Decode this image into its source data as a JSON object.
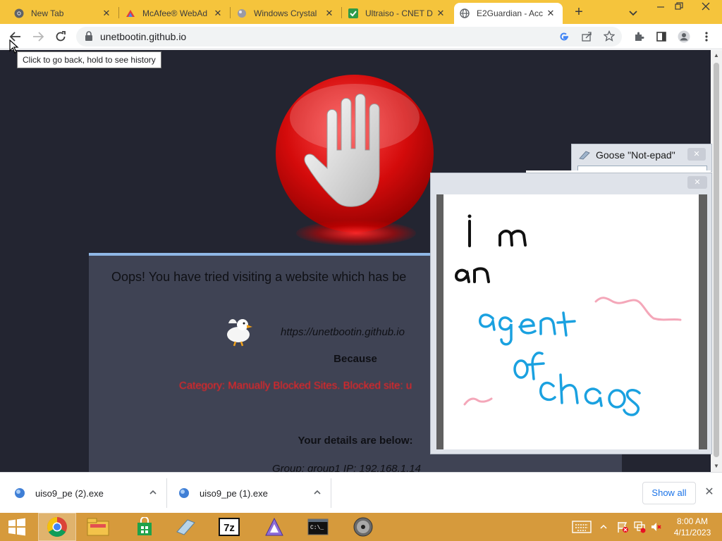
{
  "browser": {
    "tabs": [
      {
        "title": "New Tab",
        "active": false,
        "icon": "chrome-icon"
      },
      {
        "title": "McAfee® WebAd",
        "active": false,
        "icon": "mcafee-icon"
      },
      {
        "title": "Windows Crystal",
        "active": false,
        "icon": "crystal-icon"
      },
      {
        "title": "Ultraiso - CNET D",
        "active": false,
        "icon": "cnet-icon"
      },
      {
        "title": "E2Guardian - Acc",
        "active": true,
        "icon": "globe-icon"
      }
    ],
    "new_tab_label": "+",
    "url": "unetbootin.github.io",
    "back_tooltip": "Click to go back, hold to see history"
  },
  "page": {
    "heading": "Oops! You have tried visiting a website which has be",
    "blocked_url": "https://unetbootin.github.io",
    "because_label": "Because",
    "category_text": "Category: Manually Blocked Sites.  Blocked site: u",
    "details_heading": "Your details are below:",
    "group_ip": "Group: group1    IP: 192.168.1.14"
  },
  "notepad": {
    "title": "Goose \"Not-epad\"",
    "close_glyph": "✕",
    "handwriting": {
      "line1": "i m",
      "line2": "an",
      "line3": "agent",
      "line4": "of",
      "line5": "chaos"
    }
  },
  "downloads": {
    "items": [
      {
        "name": "uiso9_pe (2).exe"
      },
      {
        "name": "uiso9_pe (1).exe"
      }
    ],
    "show_all_label": "Show all",
    "close_glyph": "✕"
  },
  "taskbar": {
    "apps": [
      "chrome-icon",
      "file-explorer-icon",
      "store-icon",
      "crystal-icon",
      "7zip-icon",
      "app-icon",
      "cmd-icon",
      "disc-icon"
    ],
    "sevenzip_label": "7z",
    "cmd_label": "C:\\_",
    "time": "8:00 AM",
    "date": "4/11/2023"
  },
  "colors": {
    "tab_strip": "#f5c43c",
    "page_background": "#232531",
    "panel_background": "#3f4354",
    "panel_accent": "#8fb7e6",
    "blocked_red": "#ff2020",
    "taskbar": "#d69a3c",
    "handwriting_blue": "#1aa1e0",
    "handwriting_pink": "#f4a7b9"
  }
}
